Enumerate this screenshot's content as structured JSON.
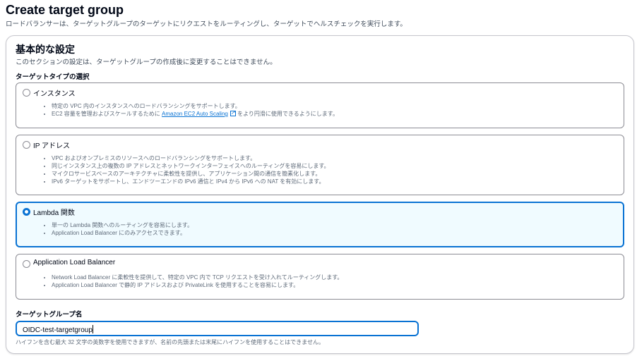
{
  "header": {
    "title": "Create target group",
    "subtitle": "ロードバランサーは、ターゲットグループのターゲットにリクエストをルーティングし、ターゲットでヘルスチェックを実行します。"
  },
  "section": {
    "title": "基本的な設定",
    "description": "このセクションの設定は、ターゲットグループの作成後に変更することはできません。",
    "target_type_label": "ターゲットタイプの選択",
    "options": [
      {
        "label": "インスタンス",
        "selected": false,
        "bullets": [
          "特定の VPC 内のインスタンスへのロードバランシングをサポートします。"
        ],
        "bullet2_pre": "EC2 容量を管理およびスケールするために ",
        "bullet2_link": "Amazon EC2 Auto Scaling",
        "bullet2_post": " をより円滑に使用できるようにします。"
      },
      {
        "label": "IP アドレス",
        "selected": false,
        "bullets": [
          "VPC およびオンプレミスのリソースへのロードバランシングをサポートします。",
          "同じインスタンス上の複数の IP アドレスとネットワークインターフェイスへのルーティングを容易にします。",
          "マイクロサービスベースのアーキテクチャに柔軟性を提供し、アプリケーション間の通信を簡素化します。",
          "IPv6 ターゲットをサポートし、エンドツーエンドの IPv6 通信と IPv4 から IPv6 への NAT を有効にします。"
        ]
      },
      {
        "label": "Lambda 関数",
        "selected": true,
        "bullets": [
          "単一の Lambda 関数へのルーティングを容易にします。",
          "Application Load Balancer にのみアクセスできます。"
        ]
      },
      {
        "label": "Application Load Balancer",
        "selected": false,
        "bullets": [
          "Network Load Balancer に柔軟性を提供して、特定の VPC 内で TCP リクエストを受け入れてルーティングします。",
          "Application Load Balancer で静的 IP アドレスおよび PrivateLink を使用することを容易にします。"
        ]
      }
    ],
    "name_label": "ターゲットグループ名",
    "name_value": "OIDC-test-targetgroup",
    "name_hint": "ハイフンを含む最大 32 文字の英数字を使用できますが、名前の先頭または末尾にハイフンを使用することはできません。"
  },
  "colors": {
    "accent": "#0972d3",
    "selected_bg": "#f0fbff"
  }
}
